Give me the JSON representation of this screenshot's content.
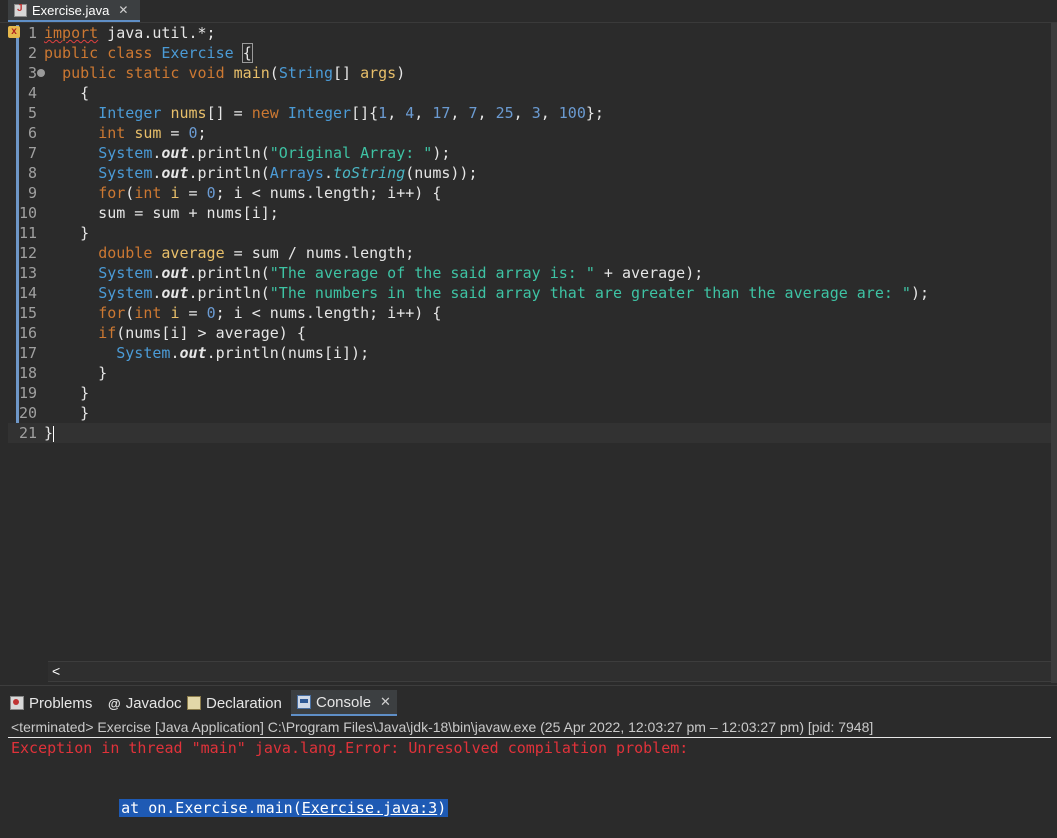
{
  "editor_tab": {
    "label": "Exercise.java",
    "close": "✕"
  },
  "editor": {
    "error_marker": "x",
    "lines": [
      {
        "n": "1",
        "tokens": [
          [
            "kw squig",
            "import"
          ],
          [
            "pl",
            " java.util.*;"
          ]
        ]
      },
      {
        "n": "2",
        "tokens": [
          [
            "kw",
            "public class "
          ],
          [
            "cls-id",
            "Exercise"
          ],
          [
            "pl",
            " "
          ],
          [
            "pl brace-hl",
            "{"
          ]
        ]
      },
      {
        "n": "3",
        "fold": true,
        "tokens": [
          [
            "pl",
            "  "
          ],
          [
            "kw",
            "public static void "
          ],
          [
            "id",
            "main"
          ],
          [
            "pl",
            "("
          ],
          [
            "ty",
            "String"
          ],
          [
            "pl",
            "[] "
          ],
          [
            "id",
            "args"
          ],
          [
            "pl",
            ")"
          ]
        ]
      },
      {
        "n": "4",
        "tokens": [
          [
            "pl",
            "    {"
          ]
        ]
      },
      {
        "n": "5",
        "tokens": [
          [
            "pl",
            "      "
          ],
          [
            "ty",
            "Integer "
          ],
          [
            "id",
            "nums"
          ],
          [
            "pl",
            "[] = "
          ],
          [
            "kw",
            "new "
          ],
          [
            "ty",
            "Integer"
          ],
          [
            "pl",
            "[]{"
          ],
          [
            "nu",
            "1"
          ],
          [
            "pl",
            ", "
          ],
          [
            "nu",
            "4"
          ],
          [
            "pl",
            ", "
          ],
          [
            "nu",
            "17"
          ],
          [
            "pl",
            ", "
          ],
          [
            "nu",
            "7"
          ],
          [
            "pl",
            ", "
          ],
          [
            "nu",
            "25"
          ],
          [
            "pl",
            ", "
          ],
          [
            "nu",
            "3"
          ],
          [
            "pl",
            ", "
          ],
          [
            "nu",
            "100"
          ],
          [
            "pl",
            "};"
          ]
        ]
      },
      {
        "n": "6",
        "tokens": [
          [
            "pl",
            "      "
          ],
          [
            "kw",
            "int "
          ],
          [
            "id",
            "sum"
          ],
          [
            "pl",
            " = "
          ],
          [
            "nu",
            "0"
          ],
          [
            "pl",
            ";"
          ]
        ]
      },
      {
        "n": "7",
        "tokens": [
          [
            "pl",
            "      "
          ],
          [
            "ty",
            "System"
          ],
          [
            "pl",
            "."
          ],
          [
            "fld",
            "out"
          ],
          [
            "pl",
            ".println("
          ],
          [
            "st",
            "\"Original Array: \""
          ],
          [
            "pl",
            ");"
          ]
        ]
      },
      {
        "n": "8",
        "tokens": [
          [
            "pl",
            "      "
          ],
          [
            "ty",
            "System"
          ],
          [
            "pl",
            "."
          ],
          [
            "fld",
            "out"
          ],
          [
            "pl",
            ".println("
          ],
          [
            "ty",
            "Arrays"
          ],
          [
            "pl",
            "."
          ],
          [
            "sm",
            "toString"
          ],
          [
            "pl",
            "(nums));"
          ]
        ]
      },
      {
        "n": "9",
        "tokens": [
          [
            "pl",
            "      "
          ],
          [
            "kw",
            "for"
          ],
          [
            "pl",
            "("
          ],
          [
            "kw",
            "int "
          ],
          [
            "id",
            "i"
          ],
          [
            "pl",
            " = "
          ],
          [
            "nu",
            "0"
          ],
          [
            "pl",
            "; i < nums.length; i++) {"
          ]
        ]
      },
      {
        "n": "10",
        "tokens": [
          [
            "pl",
            "      sum = sum + nums[i];"
          ]
        ]
      },
      {
        "n": "11",
        "tokens": [
          [
            "pl",
            "    }"
          ]
        ]
      },
      {
        "n": "12",
        "tokens": [
          [
            "pl",
            "      "
          ],
          [
            "kw",
            "double "
          ],
          [
            "id",
            "average"
          ],
          [
            "pl",
            " = sum / nums.length;"
          ]
        ]
      },
      {
        "n": "13",
        "tokens": [
          [
            "pl",
            "      "
          ],
          [
            "ty",
            "System"
          ],
          [
            "pl",
            "."
          ],
          [
            "fld",
            "out"
          ],
          [
            "pl",
            ".println("
          ],
          [
            "st",
            "\"The average of the said array is: \""
          ],
          [
            "pl",
            " + average);"
          ]
        ]
      },
      {
        "n": "14",
        "tokens": [
          [
            "pl",
            "      "
          ],
          [
            "ty",
            "System"
          ],
          [
            "pl",
            "."
          ],
          [
            "fld",
            "out"
          ],
          [
            "pl",
            ".println("
          ],
          [
            "st",
            "\"The numbers in the said array that are greater than the average are: \""
          ],
          [
            "pl",
            ");"
          ]
        ]
      },
      {
        "n": "15",
        "tokens": [
          [
            "pl",
            "      "
          ],
          [
            "kw",
            "for"
          ],
          [
            "pl",
            "("
          ],
          [
            "kw",
            "int "
          ],
          [
            "id",
            "i"
          ],
          [
            "pl",
            " = "
          ],
          [
            "nu",
            "0"
          ],
          [
            "pl",
            "; i < nums.length; i++) {"
          ]
        ]
      },
      {
        "n": "16",
        "tokens": [
          [
            "pl",
            "      "
          ],
          [
            "kw",
            "if"
          ],
          [
            "pl",
            "(nums[i] > average) {"
          ]
        ]
      },
      {
        "n": "17",
        "tokens": [
          [
            "pl",
            "        "
          ],
          [
            "ty",
            "System"
          ],
          [
            "pl",
            "."
          ],
          [
            "fld",
            "out"
          ],
          [
            "pl",
            ".println(nums[i]);"
          ]
        ]
      },
      {
        "n": "18",
        "tokens": [
          [
            "pl",
            "      }"
          ]
        ]
      },
      {
        "n": "19",
        "tokens": [
          [
            "pl",
            "    }"
          ]
        ]
      },
      {
        "n": "20",
        "tokens": [
          [
            "pl",
            "    }"
          ]
        ]
      },
      {
        "n": "21",
        "current": true,
        "cursor": true,
        "tokens": [
          [
            "pl",
            "}"
          ]
        ]
      }
    ],
    "scroll_left": "<"
  },
  "views": {
    "problems": "Problems",
    "javadoc_icon": "@",
    "javadoc": "Javadoc",
    "declaration": "Declaration",
    "console": "Console",
    "close": "✕"
  },
  "console": {
    "header": "<terminated> Exercise [Java Application] C:\\Program Files\\Java\\jdk-18\\bin\\javaw.exe  (25 Apr 2022, 12:03:27 pm – 12:03:27 pm) [pid: 7948]",
    "error_line": "Exception in thread \"main\" java.lang.Error: Unresolved compilation problem: ",
    "stack_prefix": "at on.Exercise.main(",
    "stack_link": "Exercise.java:3",
    "stack_suffix": ")"
  },
  "colors": {
    "background": "#2b2b2b",
    "keyword": "#cc7832",
    "type": "#4b9bd6",
    "string": "#3ec3a4",
    "error": "#e0323a",
    "selection": "#1e5ab4"
  }
}
